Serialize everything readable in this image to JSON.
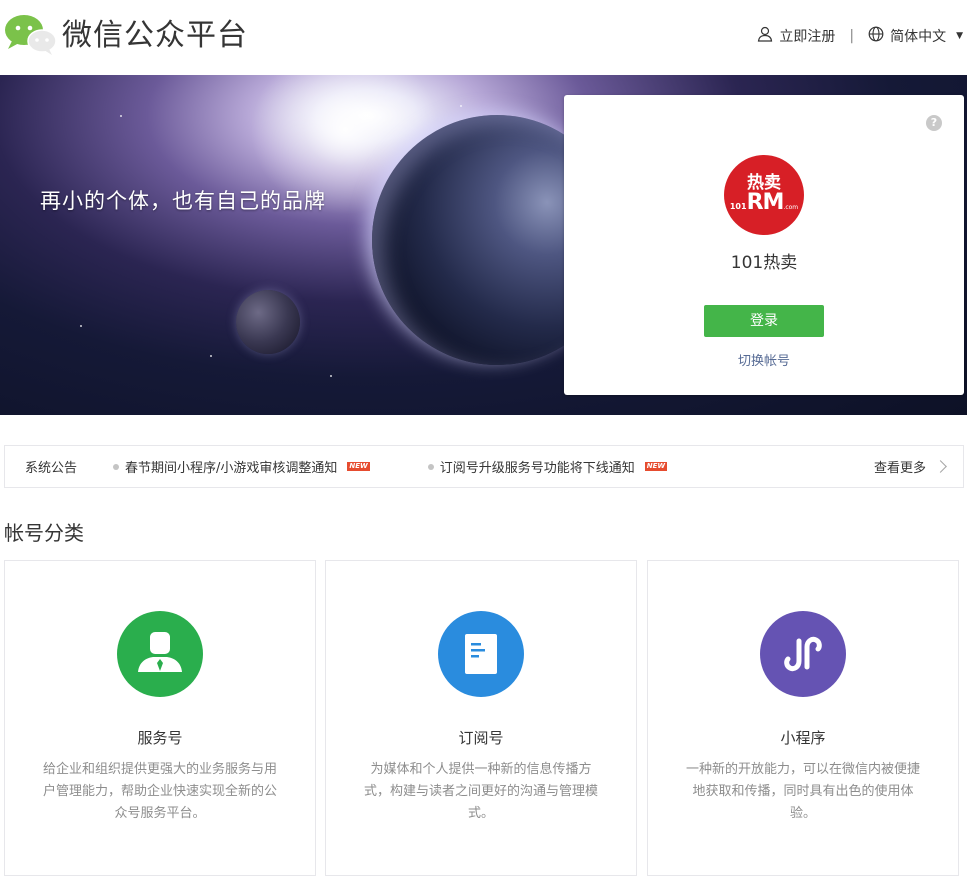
{
  "header": {
    "brand_title": "微信公众平台",
    "register_label": "立即注册",
    "separator": "|",
    "language_label": "简体中文",
    "logo_icon": "wechat-logo-icon"
  },
  "banner": {
    "slogan": "再小的个体，也有自己的品牌"
  },
  "login_card": {
    "help_label": "?",
    "avatar_text_top": "热卖",
    "avatar_text_num": "101",
    "avatar_text_rm": "RM",
    "avatar_text_com": ".com",
    "account_name": "101热卖",
    "login_button": "登录",
    "switch_account": "切换帐号"
  },
  "notice": {
    "label": "系统公告",
    "items": [
      {
        "text": "春节期间小程序/小游戏审核调整通知",
        "badge": "NEW"
      },
      {
        "text": "订阅号升级服务号功能将下线通知",
        "badge": "NEW"
      }
    ],
    "more_label": "查看更多"
  },
  "section": {
    "title": "帐号分类"
  },
  "cards": [
    {
      "name": "服务号",
      "desc": "给企业和组织提供更强大的业务服务与用户管理能力，帮助企业快速实现全新的公众号服务平台。",
      "color": "#2aae4d",
      "icon": "service-account-icon"
    },
    {
      "name": "订阅号",
      "desc": "为媒体和个人提供一种新的信息传播方式，构建与读者之间更好的沟通与管理模式。",
      "color": "#2a8cde",
      "icon": "subscription-account-icon"
    },
    {
      "name": "小程序",
      "desc": "一种新的开放能力，可以在微信内被便捷地获取和传播，同时具有出色的使用体验。",
      "color": "#6553b3",
      "icon": "mini-program-icon"
    }
  ],
  "colors": {
    "login_green": "#44b549",
    "link_blue": "#576b95",
    "new_badge": "#e64c2f"
  }
}
